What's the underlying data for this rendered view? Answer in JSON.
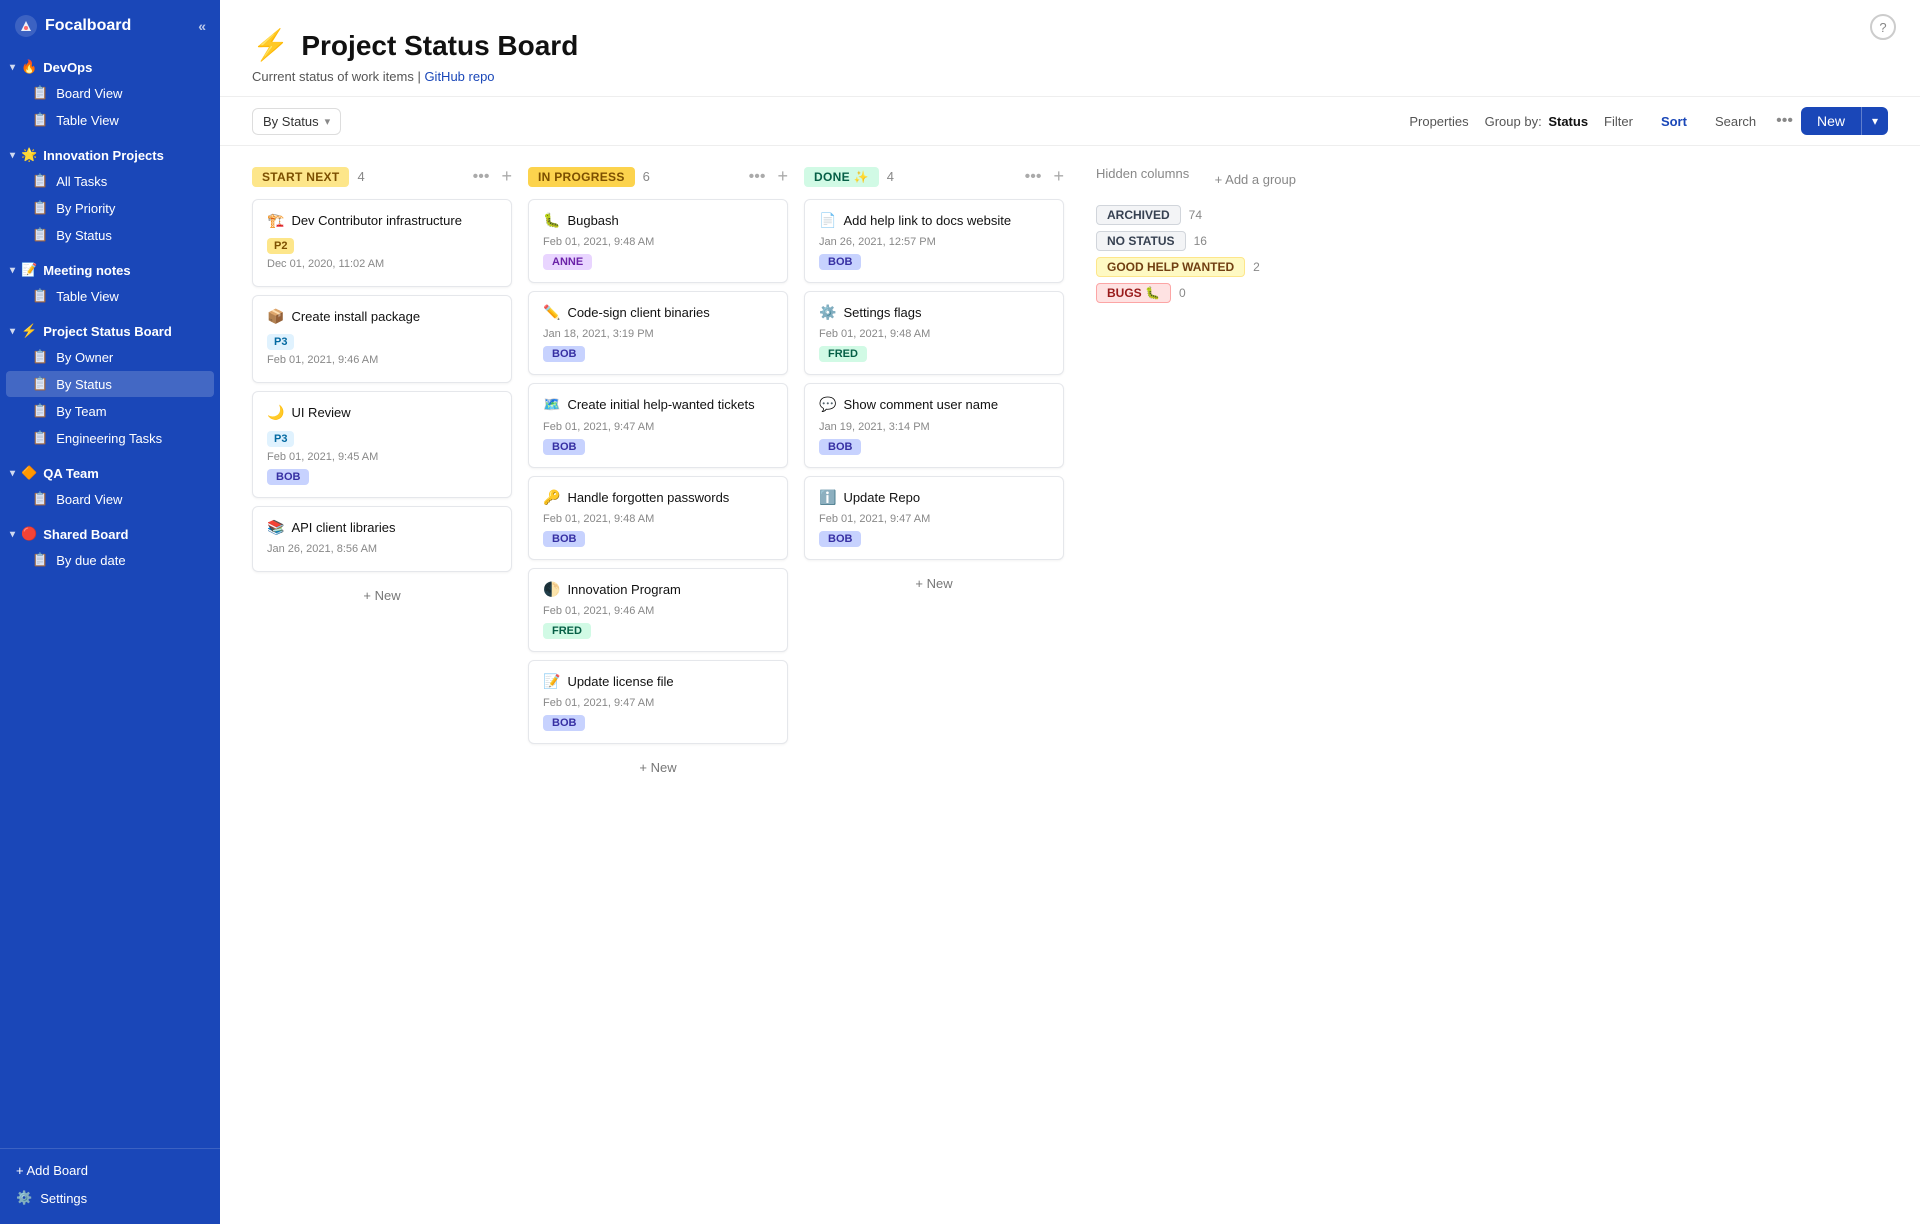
{
  "app": {
    "name": "Focalboard"
  },
  "sidebar": {
    "groups": [
      {
        "id": "devops",
        "emoji": "🔥",
        "label": "DevOps",
        "items": [
          {
            "id": "devops-board",
            "icon": "📋",
            "label": "Board View"
          },
          {
            "id": "devops-table",
            "icon": "📋",
            "label": "Table View"
          }
        ]
      },
      {
        "id": "innovation",
        "emoji": "🌟",
        "label": "Innovation Projects",
        "items": [
          {
            "id": "innov-all",
            "icon": "📋",
            "label": "All Tasks"
          },
          {
            "id": "innov-priority",
            "icon": "📋",
            "label": "By Priority"
          },
          {
            "id": "innov-status",
            "icon": "📋",
            "label": "By Status"
          }
        ]
      },
      {
        "id": "meeting",
        "emoji": "📝",
        "label": "Meeting notes",
        "items": [
          {
            "id": "meeting-table",
            "icon": "📋",
            "label": "Table View"
          }
        ]
      },
      {
        "id": "project-status",
        "emoji": "⚡",
        "label": "Project Status Board",
        "items": [
          {
            "id": "psb-owner",
            "icon": "📋",
            "label": "By Owner"
          },
          {
            "id": "psb-status",
            "icon": "📋",
            "label": "By Status",
            "active": true
          },
          {
            "id": "psb-team",
            "icon": "📋",
            "label": "By Team"
          },
          {
            "id": "psb-eng",
            "icon": "📋",
            "label": "Engineering Tasks"
          }
        ]
      },
      {
        "id": "qa",
        "emoji": "🔶",
        "label": "QA Team",
        "items": [
          {
            "id": "qa-board",
            "icon": "📋",
            "label": "Board View"
          }
        ]
      },
      {
        "id": "shared",
        "emoji": "🔴",
        "label": "Shared Board",
        "items": [
          {
            "id": "shared-date",
            "icon": "📋",
            "label": "By due date"
          }
        ]
      }
    ],
    "footer": {
      "add_board": "+ Add Board",
      "settings": "Settings"
    }
  },
  "page": {
    "emoji": "⚡",
    "title": "Project Status Board",
    "subtitle": "Current status of work items | ",
    "github_link_text": "GitHub repo"
  },
  "toolbar": {
    "view_label": "By Status",
    "properties_label": "Properties",
    "group_by_label": "Group by:",
    "group_by_value": "Status",
    "filter_label": "Filter",
    "sort_label": "Sort",
    "search_label": "Search",
    "new_label": "New"
  },
  "board": {
    "columns": [
      {
        "id": "start-next",
        "title": "START NEXT",
        "badge_class": "badge-start",
        "count": 4,
        "cards": [
          {
            "emoji": "🏗️",
            "title": "Dev Contributor infrastructure",
            "badge": "P2",
            "badge_class": "badge-p2",
            "date": "Dec 01, 2020, 11:02 AM",
            "assignee": null
          },
          {
            "emoji": "📦",
            "title": "Create install package",
            "badge": "P3",
            "badge_class": "badge-p3",
            "date": "Feb 01, 2021, 9:46 AM",
            "assignee": null
          },
          {
            "emoji": "🌙",
            "title": "UI Review",
            "badge": "P3",
            "badge_class": "badge-p3",
            "date": "Feb 01, 2021, 9:45 AM",
            "assignee": "BOB",
            "assignee_class": "assignee-bob"
          },
          {
            "emoji": "📚",
            "title": "API client libraries",
            "badge": null,
            "date": "Jan 26, 2021, 8:56 AM",
            "assignee": null
          }
        ],
        "add_new": "+ New"
      },
      {
        "id": "in-progress",
        "title": "IN PROGRESS",
        "badge_class": "badge-progress",
        "count": 6,
        "cards": [
          {
            "emoji": "🐛",
            "title": "Bugbash",
            "badge": null,
            "date": "Feb 01, 2021, 9:48 AM",
            "assignee": "ANNE",
            "assignee_class": "assignee-anne"
          },
          {
            "emoji": "✏️",
            "title": "Code-sign client binaries",
            "badge": null,
            "date": "Jan 18, 2021, 3:19 PM",
            "assignee": "BOB",
            "assignee_class": "assignee-bob"
          },
          {
            "emoji": "🗺️",
            "title": "Create initial help-wanted tickets",
            "badge": null,
            "date": "Feb 01, 2021, 9:47 AM",
            "assignee": "BOB",
            "assignee_class": "assignee-bob"
          },
          {
            "emoji": "🔑",
            "title": "Handle forgotten passwords",
            "badge": null,
            "date": "Feb 01, 2021, 9:48 AM",
            "assignee": "BOB",
            "assignee_class": "assignee-bob"
          },
          {
            "emoji": "🌓",
            "title": "Innovation Program",
            "badge": null,
            "date": "Feb 01, 2021, 9:46 AM",
            "assignee": "FRED",
            "assignee_class": "assignee-fred"
          },
          {
            "emoji": "📝",
            "title": "Update license file",
            "badge": null,
            "date": "Feb 01, 2021, 9:47 AM",
            "assignee": "BOB",
            "assignee_class": "assignee-bob"
          }
        ],
        "add_new": "+ New"
      },
      {
        "id": "done",
        "title": "DONE ✨",
        "badge_class": "badge-done",
        "count": 4,
        "cards": [
          {
            "emoji": "📄",
            "title": "Add help link to docs website",
            "badge": null,
            "date": "Jan 26, 2021, 12:57 PM",
            "assignee": "BOB",
            "assignee_class": "assignee-bob"
          },
          {
            "emoji": "⚙️",
            "title": "Settings flags",
            "badge": null,
            "date": "Feb 01, 2021, 9:48 AM",
            "assignee": "FRED",
            "assignee_class": "assignee-fred"
          },
          {
            "emoji": "💬",
            "title": "Show comment user name",
            "badge": null,
            "date": "Jan 19, 2021, 3:14 PM",
            "assignee": "BOB",
            "assignee_class": "assignee-bob"
          },
          {
            "emoji": "ℹ️",
            "title": "Update Repo",
            "badge": null,
            "date": "Feb 01, 2021, 9:47 AM",
            "assignee": "BOB",
            "assignee_class": "assignee-bob"
          }
        ],
        "add_new": "+ New"
      }
    ],
    "hidden_columns": {
      "title": "Hidden columns",
      "add_group": "+ Add a group",
      "items": [
        {
          "id": "archived",
          "label": "ARCHIVED",
          "badge_class": "badge-archived",
          "count": "74"
        },
        {
          "id": "no-status",
          "label": "NO STATUS",
          "badge_class": "badge-no-status",
          "count": "16"
        },
        {
          "id": "good-help",
          "label": "GOOD HELP WANTED",
          "badge_class": "badge-good-help",
          "count": "2"
        },
        {
          "id": "bugs",
          "label": "BUGS 🐛",
          "badge_class": "badge-bugs",
          "count": "0"
        }
      ]
    }
  },
  "help": "?"
}
